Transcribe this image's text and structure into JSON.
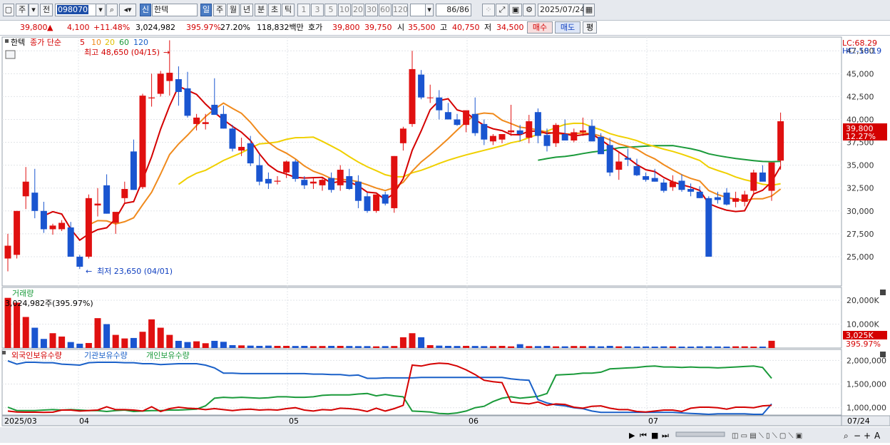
{
  "toolbar": {
    "market": "주",
    "jeon": "전",
    "code": "098070",
    "sin": "신",
    "stock_name": "한텍",
    "periods": [
      "일",
      "주",
      "월",
      "년",
      "분",
      "초",
      "틱"
    ],
    "active_period": "일",
    "intervals": [
      "1",
      "3",
      "5",
      "10",
      "20",
      "30",
      "60",
      "120"
    ],
    "count": "86/86",
    "date": "2025/07/24"
  },
  "info": {
    "price": "39,800",
    "change": "4,100",
    "change_rate": "+11.48%",
    "volume": "3,024,982",
    "volume_rate": "395.97%",
    "turnover": "27.20%",
    "amount": "118,832백만",
    "hoga_label": "호가",
    "ask": "39,800",
    "bid": "39,750",
    "open_label": "시",
    "open": "35,500",
    "high_label": "고",
    "high": "40,750",
    "low_label": "저",
    "low": "34,500",
    "buy": "매수",
    "sell": "매도",
    "pyeong": "평"
  },
  "price_panel": {
    "title": "한텍",
    "ma_label": "종가 단순",
    "ma_periods": [
      "5",
      "10",
      "20",
      "60",
      "120"
    ],
    "ma_colors": [
      "#d40000",
      "#f08a1c",
      "#f0d000",
      "#1a9a3a",
      "#1a60c8"
    ],
    "max_label": "최고 48,650 (04/15)",
    "min_label": "최저 23,650 (04/01)",
    "lc": "LC:68.29",
    "hc": "HC:-18.19",
    "current_price_label": "39,800",
    "current_pct_label": "12.27%",
    "y_ticks": [
      "47,500",
      "45,000",
      "42,500",
      "40,000",
      "37,500",
      "35,000",
      "32,500",
      "30,000",
      "27,500",
      "25,000"
    ]
  },
  "volume_panel": {
    "title": "거래량",
    "value_label": "3,024,982주(395.97%)",
    "y_ticks": [
      "20,000K",
      "10,000K"
    ],
    "current_label": "3,025K",
    "current_pct": "395.97%"
  },
  "holding_panel": {
    "legends": [
      "외국인보유수량",
      "기관보유수량",
      "개인보유수량"
    ],
    "y_ticks": [
      "2,000,000",
      "1,500,000",
      "1,000,000"
    ]
  },
  "x_axis": {
    "labels": [
      "2025/03",
      "04",
      "05",
      "06",
      "07"
    ],
    "right_label": "07/24"
  },
  "chart_data": {
    "type": "candlestick",
    "series_count": 86,
    "y_range": [
      23000,
      49000
    ],
    "candles": [
      {
        "o": 24800,
        "h": 27500,
        "l": 23400,
        "c": 26200
      },
      {
        "o": 25200,
        "h": 30000,
        "l": 24800,
        "c": 30000
      },
      {
        "o": 31600,
        "h": 34800,
        "l": 30200,
        "c": 33200
      },
      {
        "o": 32000,
        "h": 34600,
        "l": 29200,
        "c": 30000
      },
      {
        "o": 30000,
        "h": 31000,
        "l": 27600,
        "c": 28000
      },
      {
        "o": 28000,
        "h": 28600,
        "l": 27400,
        "c": 28400
      },
      {
        "o": 28000,
        "h": 29000,
        "l": 27800,
        "c": 28700
      },
      {
        "o": 28200,
        "h": 28800,
        "l": 25000,
        "c": 25000
      },
      {
        "o": 25000,
        "h": 25200,
        "l": 23650,
        "c": 23900
      },
      {
        "o": 25000,
        "h": 31800,
        "l": 24800,
        "c": 31400
      },
      {
        "o": 30600,
        "h": 32500,
        "l": 29400,
        "c": 30800
      },
      {
        "o": 32800,
        "h": 34000,
        "l": 29700,
        "c": 29700
      },
      {
        "o": 28700,
        "h": 29500,
        "l": 27500,
        "c": 29900
      },
      {
        "o": 31400,
        "h": 33200,
        "l": 30800,
        "c": 32400
      },
      {
        "o": 36500,
        "h": 37800,
        "l": 32300,
        "c": 32300
      },
      {
        "o": 32600,
        "h": 42800,
        "l": 32400,
        "c": 42600
      },
      {
        "o": 42300,
        "h": 45000,
        "l": 41400,
        "c": 42400
      },
      {
        "o": 42800,
        "h": 45300,
        "l": 42500,
        "c": 45000
      },
      {
        "o": 44200,
        "h": 48650,
        "l": 42600,
        "c": 45100
      },
      {
        "o": 44400,
        "h": 45800,
        "l": 41500,
        "c": 43000
      },
      {
        "o": 43400,
        "h": 45200,
        "l": 40200,
        "c": 40400
      },
      {
        "o": 39500,
        "h": 40600,
        "l": 38800,
        "c": 40200
      },
      {
        "o": 39500,
        "h": 40600,
        "l": 38900,
        "c": 39700
      },
      {
        "o": 41600,
        "h": 44500,
        "l": 41200,
        "c": 40500
      },
      {
        "o": 40600,
        "h": 41500,
        "l": 39000,
        "c": 39000
      },
      {
        "o": 39000,
        "h": 39400,
        "l": 36500,
        "c": 36800
      },
      {
        "o": 36600,
        "h": 38000,
        "l": 36000,
        "c": 37000
      },
      {
        "o": 37400,
        "h": 38200,
        "l": 34900,
        "c": 35200
      },
      {
        "o": 35000,
        "h": 36200,
        "l": 32800,
        "c": 33200
      },
      {
        "o": 33500,
        "h": 34200,
        "l": 32400,
        "c": 33000
      },
      {
        "o": 33200,
        "h": 33800,
        "l": 32900,
        "c": 33300
      },
      {
        "o": 34200,
        "h": 35500,
        "l": 33600,
        "c": 35400
      },
      {
        "o": 35400,
        "h": 35600,
        "l": 33200,
        "c": 33500
      },
      {
        "o": 33400,
        "h": 33800,
        "l": 32400,
        "c": 32800
      },
      {
        "o": 33000,
        "h": 33600,
        "l": 32400,
        "c": 33200
      },
      {
        "o": 32800,
        "h": 33600,
        "l": 32200,
        "c": 33400
      },
      {
        "o": 33600,
        "h": 34200,
        "l": 32000,
        "c": 32300
      },
      {
        "o": 32800,
        "h": 35000,
        "l": 32200,
        "c": 34500
      },
      {
        "o": 33800,
        "h": 34600,
        "l": 32300,
        "c": 32400
      },
      {
        "o": 33200,
        "h": 33900,
        "l": 30300,
        "c": 31100
      },
      {
        "o": 31600,
        "h": 32000,
        "l": 29800,
        "c": 30000
      },
      {
        "o": 30000,
        "h": 31800,
        "l": 29800,
        "c": 31800
      },
      {
        "o": 31800,
        "h": 32100,
        "l": 30600,
        "c": 30800
      },
      {
        "o": 30300,
        "h": 36000,
        "l": 29800,
        "c": 36000
      },
      {
        "o": 37400,
        "h": 39200,
        "l": 36600,
        "c": 39000
      },
      {
        "o": 39500,
        "h": 47500,
        "l": 39200,
        "c": 45500
      },
      {
        "o": 44900,
        "h": 45400,
        "l": 42200,
        "c": 42400
      },
      {
        "o": 42400,
        "h": 43800,
        "l": 41800,
        "c": 42400
      },
      {
        "o": 42400,
        "h": 43200,
        "l": 40000,
        "c": 41000
      },
      {
        "o": 40800,
        "h": 41800,
        "l": 40100,
        "c": 40000
      },
      {
        "o": 40000,
        "h": 40600,
        "l": 39300,
        "c": 39400
      },
      {
        "o": 39400,
        "h": 40800,
        "l": 38600,
        "c": 41000
      },
      {
        "o": 40600,
        "h": 42400,
        "l": 38200,
        "c": 38500
      },
      {
        "o": 39500,
        "h": 40000,
        "l": 37200,
        "c": 37800
      },
      {
        "o": 37600,
        "h": 38400,
        "l": 37200,
        "c": 38200
      },
      {
        "o": 37800,
        "h": 38200,
        "l": 37400,
        "c": 38400
      },
      {
        "o": 38600,
        "h": 41600,
        "l": 38200,
        "c": 38800
      },
      {
        "o": 38800,
        "h": 39400,
        "l": 37600,
        "c": 38400
      },
      {
        "o": 38000,
        "h": 40500,
        "l": 37400,
        "c": 39800
      },
      {
        "o": 40800,
        "h": 41200,
        "l": 37400,
        "c": 38200
      },
      {
        "o": 38300,
        "h": 39000,
        "l": 36500,
        "c": 37100
      },
      {
        "o": 37400,
        "h": 39600,
        "l": 37000,
        "c": 39400
      },
      {
        "o": 38400,
        "h": 40000,
        "l": 37700,
        "c": 37700
      },
      {
        "o": 37700,
        "h": 39000,
        "l": 37500,
        "c": 38600
      },
      {
        "o": 38600,
        "h": 40200,
        "l": 38200,
        "c": 38800
      },
      {
        "o": 39300,
        "h": 40000,
        "l": 37600,
        "c": 37600
      },
      {
        "o": 38100,
        "h": 38500,
        "l": 36800,
        "c": 36200
      },
      {
        "o": 37200,
        "h": 38000,
        "l": 33800,
        "c": 34200
      },
      {
        "o": 34500,
        "h": 36400,
        "l": 33400,
        "c": 35400
      },
      {
        "o": 35800,
        "h": 36800,
        "l": 34900,
        "c": 35600
      },
      {
        "o": 34900,
        "h": 35700,
        "l": 33800,
        "c": 33900
      },
      {
        "o": 33800,
        "h": 34200,
        "l": 33200,
        "c": 33400
      },
      {
        "o": 33600,
        "h": 34600,
        "l": 33200,
        "c": 33200
      },
      {
        "o": 33100,
        "h": 33500,
        "l": 32000,
        "c": 32200
      },
      {
        "o": 32600,
        "h": 33900,
        "l": 32200,
        "c": 33200
      },
      {
        "o": 33300,
        "h": 34000,
        "l": 32100,
        "c": 32300
      },
      {
        "o": 32400,
        "h": 33000,
        "l": 31600,
        "c": 32100
      },
      {
        "o": 32100,
        "h": 32700,
        "l": 31400,
        "c": 31400
      },
      {
        "o": 31400,
        "h": 31600,
        "l": 25000,
        "c": 25000
      },
      {
        "o": 31500,
        "h": 32100,
        "l": 30800,
        "c": 31200
      },
      {
        "o": 32000,
        "h": 32500,
        "l": 30600,
        "c": 30700
      },
      {
        "o": 31000,
        "h": 32100,
        "l": 30400,
        "c": 31400
      },
      {
        "o": 31000,
        "h": 32200,
        "l": 30500,
        "c": 31800
      },
      {
        "o": 32200,
        "h": 34500,
        "l": 31700,
        "c": 34200
      },
      {
        "o": 34200,
        "h": 35000,
        "l": 33300,
        "c": 33200
      },
      {
        "o": 32200,
        "h": 35300,
        "l": 31100,
        "c": 35300
      },
      {
        "o": 35500,
        "h": 40750,
        "l": 34500,
        "c": 39800
      }
    ],
    "volumes": [
      21000,
      19000,
      13000,
      8500,
      3800,
      6200,
      4800,
      2500,
      1800,
      2100,
      12500,
      10000,
      5500,
      4000,
      4200,
      6800,
      12000,
      8500,
      5500,
      3000,
      2500,
      2800,
      2000,
      3000,
      2600,
      1200,
      1100,
      1000,
      900,
      1000,
      900,
      900,
      850,
      900,
      800,
      850,
      900,
      900,
      850,
      800,
      800,
      700,
      800,
      850,
      4500,
      6200,
      4500,
      1200,
      1000,
      900,
      850,
      900,
      850,
      800,
      800,
      900,
      700,
      1600,
      800,
      800,
      900,
      700,
      700,
      850,
      800,
      800,
      700,
      900,
      700,
      700,
      600,
      650,
      600,
      700,
      700,
      600,
      600,
      700,
      700,
      650,
      600,
      700,
      700,
      600,
      600,
      3025
    ],
    "holdings_foreign": [
      930000,
      910000,
      905000,
      905000,
      900000,
      905000,
      950000,
      950000,
      930000,
      940000,
      950000,
      1020000,
      960000,
      960000,
      950000,
      930000,
      1020000,
      920000,
      980000,
      1010000,
      990000,
      980000,
      960000,
      980000,
      960000,
      940000,
      960000,
      970000,
      950000,
      960000,
      950000,
      980000,
      1000000,
      950000,
      930000,
      960000,
      950000,
      990000,
      980000,
      960000,
      920000,
      990000,
      930000,
      980000,
      1050000,
      1900000,
      1880000,
      1920000,
      1940000,
      1930000,
      1880000,
      1800000,
      1700000,
      1580000,
      1550000,
      1530000,
      1120000,
      1100000,
      1080000,
      1120000,
      1050000,
      1080000,
      1070000,
      1010000,
      990000,
      1030000,
      1040000,
      990000,
      960000,
      960000,
      920000,
      910000,
      930000,
      950000,
      950000,
      920000,
      990000,
      1010000,
      1010000,
      1000000,
      970000,
      1010000,
      1010000,
      1000000,
      1040000,
      1050000
    ],
    "holdings_institution": [
      1990000,
      1920000,
      1960000,
      1960000,
      1950000,
      1950000,
      1920000,
      1910000,
      1900000,
      1950000,
      1960000,
      1960000,
      1960000,
      1950000,
      1950000,
      1930000,
      1930000,
      1910000,
      1920000,
      1930000,
      1930000,
      1930000,
      1900000,
      1840000,
      1730000,
      1730000,
      1720000,
      1720000,
      1720000,
      1720000,
      1720000,
      1720000,
      1720000,
      1720000,
      1710000,
      1710000,
      1700000,
      1700000,
      1680000,
      1690000,
      1620000,
      1620000,
      1630000,
      1630000,
      1630000,
      1630000,
      1640000,
      1640000,
      1640000,
      1640000,
      1640000,
      1640000,
      1640000,
      1640000,
      1640000,
      1640000,
      1610000,
      1590000,
      1580000,
      1170000,
      1100000,
      1060000,
      1040000,
      1000000,
      980000,
      930000,
      900000,
      900000,
      900000,
      900000,
      900000,
      900000,
      900000,
      900000,
      900000,
      890000,
      880000,
      870000,
      860000,
      870000,
      870000,
      870000,
      870000,
      860000,
      860000,
      1080000
    ],
    "holdings_individual": [
      1010000,
      940000,
      940000,
      940000,
      950000,
      960000,
      950000,
      960000,
      950000,
      940000,
      940000,
      920000,
      940000,
      950000,
      920000,
      930000,
      940000,
      940000,
      950000,
      950000,
      960000,
      970000,
      1040000,
      1200000,
      1220000,
      1210000,
      1220000,
      1210000,
      1200000,
      1210000,
      1230000,
      1230000,
      1220000,
      1220000,
      1230000,
      1260000,
      1270000,
      1270000,
      1270000,
      1290000,
      1300000,
      1250000,
      1280000,
      1250000,
      1230000,
      930000,
      920000,
      910000,
      880000,
      870000,
      890000,
      930000,
      1000000,
      1030000,
      1130000,
      1200000,
      1230000,
      1200000,
      1220000,
      1240000,
      1300000,
      1690000,
      1700000,
      1710000,
      1730000,
      1730000,
      1750000,
      1820000,
      1830000,
      1840000,
      1850000,
      1870000,
      1880000,
      1860000,
      1860000,
      1850000,
      1860000,
      1850000,
      1850000,
      1840000,
      1850000,
      1860000,
      1870000,
      1880000,
      1850000,
      1620000
    ]
  }
}
